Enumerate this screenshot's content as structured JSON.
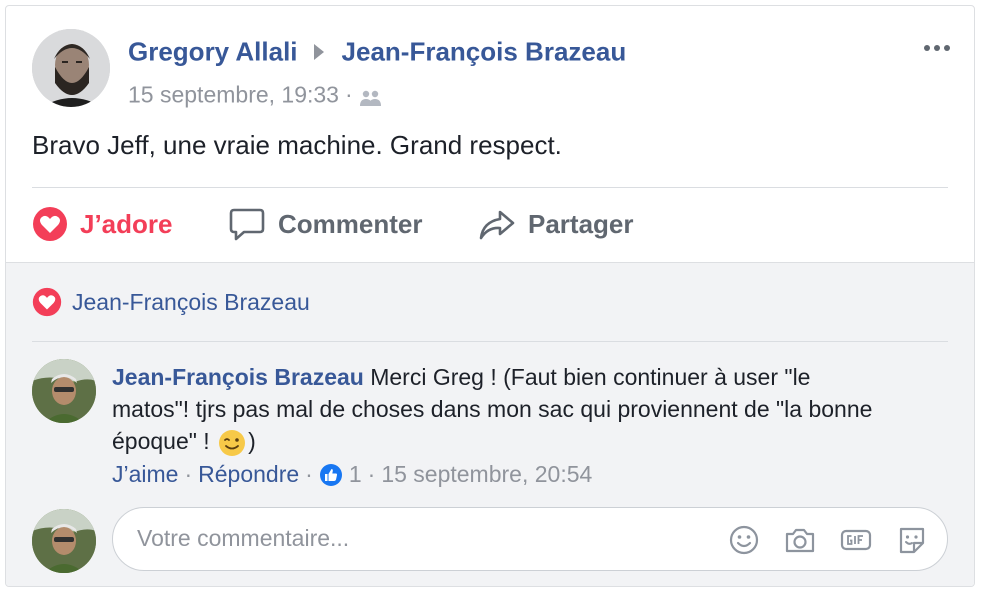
{
  "post": {
    "author": "Gregory Allali",
    "target": "Jean-François Brazeau",
    "timestamp": "15 septembre, 19:33",
    "separator": "·",
    "text": "Bravo Jeff, une vraie machine. Grand respect."
  },
  "actions": {
    "love_label": "J’adore",
    "comment_label": "Commenter",
    "share_label": "Partager"
  },
  "reactions": {
    "reactor": "Jean-François Brazeau"
  },
  "comment": {
    "author": "Jean-François Brazeau",
    "text_before_emoji": "Merci Greg ! (Faut bien continuer à user \"le matos\"! tjrs pas mal de choses dans mon sac qui proviennent de \"la bonne époque\" !",
    "text_after_emoji": ")",
    "like_label": "J’aime",
    "reply_label": "Répondre",
    "like_count": "1",
    "timestamp": "15 septembre, 20:54",
    "sep": "·"
  },
  "composer": {
    "placeholder": "Votre commentaire..."
  },
  "colors": {
    "link": "#385898",
    "love": "#f33e58",
    "muted": "#90949c",
    "action": "#606770",
    "comment_bg": "#f2f3f5"
  },
  "icons": [
    "arrow-right-icon",
    "audience-friends-icon",
    "more-options-icon",
    "heart-icon",
    "comment-icon",
    "share-icon",
    "wink-emoji-icon",
    "like-badge-icon",
    "emoji-icon",
    "camera-icon",
    "gif-icon",
    "sticker-icon"
  ]
}
